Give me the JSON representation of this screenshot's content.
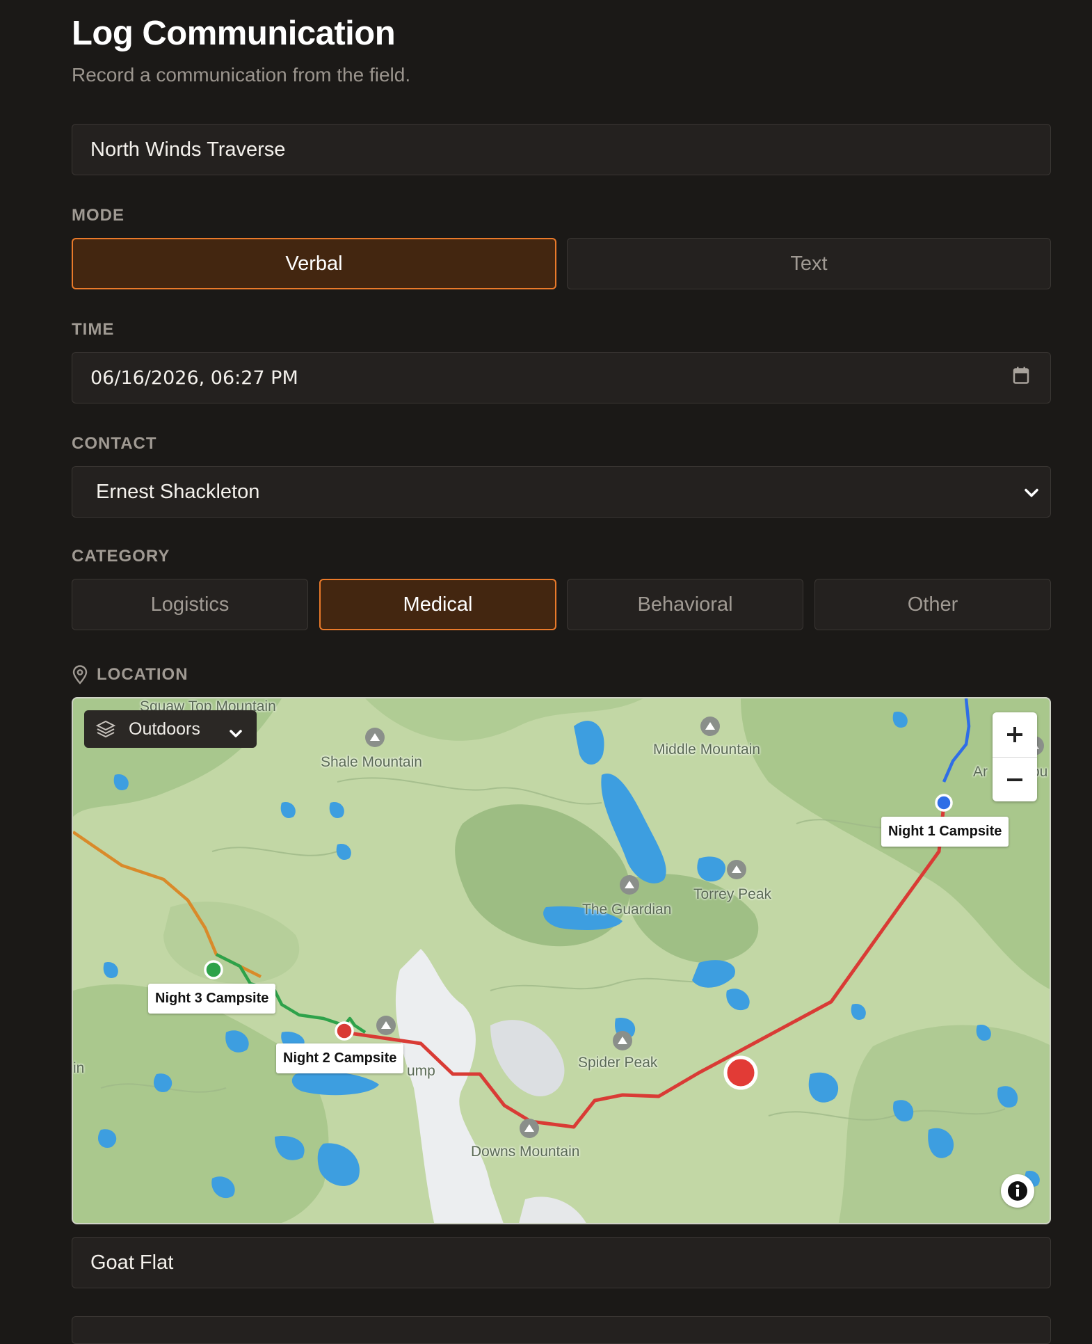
{
  "page": {
    "title": "Log Communication",
    "subtitle": "Record a communication from the field."
  },
  "trip": {
    "value": "North Winds Traverse"
  },
  "mode": {
    "label": "MODE",
    "options": [
      "Verbal",
      "Text"
    ],
    "selected": "Verbal"
  },
  "time": {
    "label": "TIME",
    "value": "06/16/2026, 06:27 PM",
    "icon": "calendar-icon"
  },
  "contact": {
    "label": "CONTACT",
    "value": "Ernest Shackleton",
    "icon": "chevron-down-icon"
  },
  "category": {
    "label": "CATEGORY",
    "options": [
      "Logistics",
      "Medical",
      "Behavioral",
      "Other"
    ],
    "selected": "Medical"
  },
  "location": {
    "label": "LOCATION",
    "icon": "map-pin-icon",
    "layer_selector": {
      "label": "Outdoors",
      "icon": "layers-icon"
    },
    "zoom": {
      "in": "+",
      "out": "−"
    },
    "campsites": [
      "Night 1 Campsite",
      "Night 2 Campsite",
      "Night 3 Campsite"
    ],
    "peaks": [
      "Shale Mountain",
      "Middle Mountain",
      "Torrey Peak",
      "The Guardian",
      "Spider Peak",
      "Downs Mountain"
    ],
    "edge_fragments": [
      "Squaw Top Mountain",
      "Ar",
      "ou",
      "in",
      "ump"
    ],
    "place_value": "Goat Flat"
  },
  "colors": {
    "accent": "#ea7a2a",
    "route_red": "#d93b35",
    "route_green": "#2ea24a",
    "route_orange": "#d98a2a",
    "route_blue": "#2f6ee6"
  }
}
